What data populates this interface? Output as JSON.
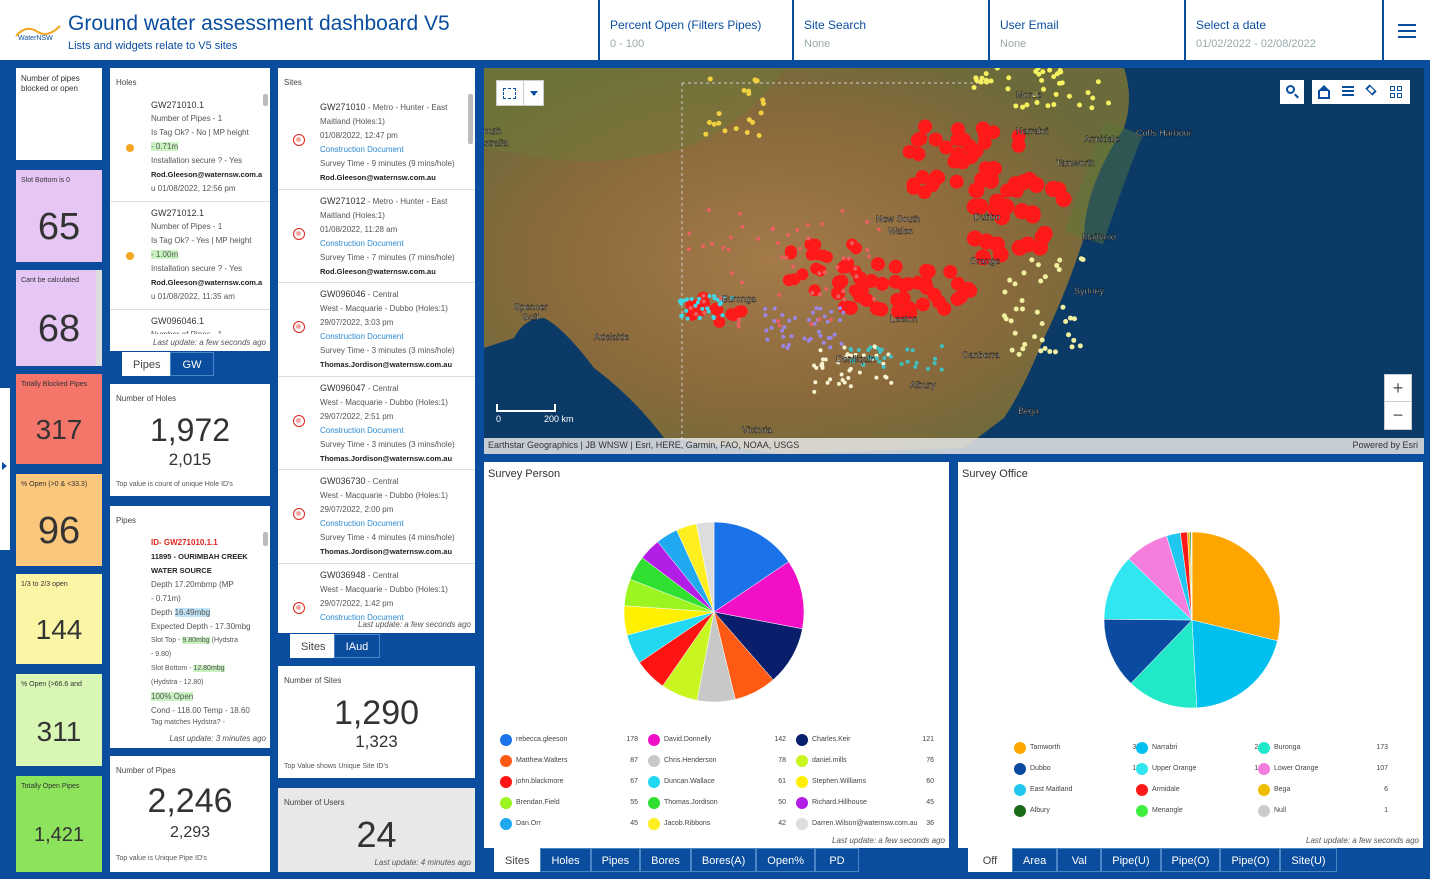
{
  "header": {
    "logo_text": "WaterNSW",
    "title": "Ground water assessment dashboard V5",
    "subtitle": "Lists and widgets relate to V5 sites",
    "filters": [
      {
        "label": "Percent Open (Filters Pipes)",
        "value": "0 - 100"
      },
      {
        "label": "Site Search",
        "value": "None"
      },
      {
        "label": "User Email",
        "value": "None"
      },
      {
        "label": "Select a date",
        "value": "01/02/2022 - 02/08/2022"
      }
    ]
  },
  "indicators": [
    {
      "title": "Number of pipes blocked or open",
      "value": "",
      "color": "#ffffff"
    },
    {
      "title": "Slot Bottom is 0",
      "value": "65",
      "color": "#e6c6f5"
    },
    {
      "title": "Cant be calculated",
      "value": "68",
      "color": "#e6c6f5"
    },
    {
      "title": "Totally Blocked Pipes",
      "value": "317",
      "color": "#f4756a"
    },
    {
      "title": "% Open (>0 & <33.3)",
      "value": "96",
      "color": "#fbc77c"
    },
    {
      "title": "1/3 to 2/3 open",
      "value": "144",
      "color": "#fbf6a6"
    },
    {
      "title": "% Open (>66.6 and",
      "value": "311",
      "color": "#d8f7b4"
    },
    {
      "title": "Totally Open Pipes",
      "value": "1,421",
      "color": "#8ee35d"
    }
  ],
  "holes": {
    "title": "Holes",
    "items": [
      {
        "id": "GW271010.1",
        "pipes": "Number of Pipes - 1",
        "tag": "Is Tag Ok? - No | MP height",
        "height": "- 0.71m",
        "install": "Installation secure ? - Yes",
        "email": "Rod.Gleeson@waternsw.com.a",
        "date": "u 01/08/2022, 12:56 pm"
      },
      {
        "id": "GW271012.1",
        "pipes": "Number of Pipes - 1",
        "tag": "Is Tag Ok? - Yes | MP height",
        "height": "- 1.00m",
        "install": "Installation secure ? - Yes",
        "email": "Rod.Gleeson@waternsw.com.a",
        "date": "u 01/08/2022, 11:35 am"
      },
      {
        "id": "GW096046.1",
        "pipes": "Number of Pipes - 1"
      }
    ],
    "updated": "Last update: a few seconds ago",
    "tabs": [
      "Pipes",
      "GW"
    ]
  },
  "number_of_holes": {
    "title": "Number of Holes",
    "value": "1,972",
    "subvalue": "2,015",
    "note": "Top value is count of unique Hole ID's"
  },
  "pipes": {
    "title": "Pipes",
    "id": "ID- GW271010.1.1",
    "site": "11895 - OURIMBAH CREEK",
    "source": "WATER SOURCE",
    "depth": "Depth 17.20mbmp (MP",
    "depth2": "- 0.71m)",
    "depth_label": "Depth",
    "depth_val": "16.49mbg",
    "expected": "Expected Depth - 17.30mbg",
    "slot_top_label": "Slot Top -",
    "slot_top_val": "9.80mbg",
    "slot_top_hyd": "(Hydstra",
    "slot_top_hyd2": "- 9.80)",
    "slot_bottom_label": "Slot Bottom -",
    "slot_bottom_val": "12.80mbg",
    "slot_bottom_hyd": "(Hydstra - 12.80)",
    "open": "100% Open",
    "cond": "Cond - 118.00 Temp - 18.60",
    "tag": "Tag matches Hydstra? -",
    "updated": "Last update: 3 minutes ago"
  },
  "number_of_pipes": {
    "title": "Number of Pipes",
    "value": "2,246",
    "subvalue": "2,293",
    "note": "Top value is Unique Pipe ID's"
  },
  "sites": {
    "title": "Sites",
    "items": [
      {
        "id": "GW271010",
        "l1": " - Metro - Hunter - East",
        "l2": "Maitland (Holes:1)",
        "date": "01/08/2022, 12:47 pm",
        "doc": "Construction Document",
        "survey": "Survey Time - 9 minutes (9 mins/hole)",
        "email": "Rod.Gleeson@waternsw.com.au"
      },
      {
        "id": "GW271012",
        "l1": " - Metro - Hunter - East",
        "l2": "Maitland (Holes:1)",
        "date": "01/08/2022, 11:28 am",
        "doc": "Construction Document",
        "survey": "Survey Time - 7 minutes (7 mins/hole)",
        "email": "Rod.Gleeson@waternsw.com.au"
      },
      {
        "id": "GW096046",
        "l1": " - Central",
        "l2": "West - Macquarie - Dubbo (Holes:1)",
        "date": "29/07/2022, 3:03 pm",
        "doc": "Construction Document",
        "survey": "Survey Time - 3 minutes (3 mins/hole)",
        "email": "Thomas.Jordison@waternsw.com.au"
      },
      {
        "id": "GW096047",
        "l1": " - Central",
        "l2": "West - Macquarie - Dubbo (Holes:1)",
        "date": "29/07/2022, 2:51 pm",
        "doc": "Construction Document",
        "survey": "Survey Time - 3 minutes (3 mins/hole)",
        "email": "Thomas.Jordison@waternsw.com.au"
      },
      {
        "id": "GW036730",
        "l1": " - Central",
        "l2": "West - Macquarie - Dubbo (Holes:1)",
        "date": "29/07/2022, 2:00 pm",
        "doc": "Construction Document",
        "survey": "Survey Time - 4 minutes (4 mins/hole)",
        "email": "Thomas.Jordison@waternsw.com.au"
      },
      {
        "id": "GW036948",
        "l1": " - Central",
        "l2": "West - Macquarie - Dubbo (Holes:1)",
        "date": "29/07/2022, 1:42 pm",
        "doc": "Construction Document",
        "survey": "",
        "email": ""
      }
    ],
    "updated": "Last update: a few seconds ago",
    "tabs": [
      "Sites",
      "IAud"
    ]
  },
  "number_of_sites": {
    "title": "Number of Sites",
    "value": "1,290",
    "subvalue": "1,323",
    "note": "Top Value shows Unique Site ID's"
  },
  "number_of_users": {
    "title": "Number of Users",
    "value": "24",
    "updated": "Last update: 4 minutes ago"
  },
  "map": {
    "labels": [
      "Moree",
      "Narrabri",
      "Armidale",
      "Coffs Harbour",
      "Tamworth",
      "New South",
      "Wales",
      "Dubbo",
      "Maitland",
      "Orange",
      "Sydney",
      "Buronga",
      "Leeton",
      "Adelaide",
      "Spencer",
      "Gulf",
      "Deniliquin",
      "Canberra",
      "Albury",
      "Victoria",
      "Bega",
      "outh",
      "stralia"
    ],
    "scale": "200 km",
    "scale_zero": "0",
    "attribution": "Earthstar Geographics | JB WNSW | Esri, HERE, Garmin, FAO, NOAA, USGS",
    "powered": "Powered by Esri",
    "zoom_in": "+",
    "zoom_out": "−"
  },
  "survey_person": {
    "title": "Survey Person",
    "updated": "Last update: a few seconds ago",
    "tabs": [
      "Sites",
      "Holes",
      "Pipes",
      "Bores",
      "Bores(A)",
      "Open%",
      "PD"
    ],
    "chart_data": {
      "type": "pie",
      "title": "Survey Person",
      "categories": [
        "rebecca.gleeson",
        "David.Donnelly",
        "Charles.Keir",
        "Matthew.Walters",
        "Chris.Henderson",
        "daniel.mills",
        "john.blackmore",
        "Duncan.Wallace",
        "Stephen.Williams",
        "Brendan.Field",
        "Thomas.Jordison",
        "Richard.Hillhouse",
        "Dan.Orr",
        "Jacob.Ribbons",
        "Darren.Wilson@waternsw.com.au"
      ],
      "values": [
        178,
        142,
        121,
        87,
        78,
        76,
        67,
        61,
        60,
        55,
        50,
        45,
        45,
        42,
        36
      ],
      "colors": [
        "#1a73e8",
        "#f20fc8",
        "#0a1f6b",
        "#ff5a14",
        "#c8c8c8",
        "#c9f520",
        "#ff1414",
        "#22d8f0",
        "#fff000",
        "#9cf520",
        "#30e030",
        "#b31ee6",
        "#20a8f0",
        "#ffee20",
        "#dddddd"
      ]
    }
  },
  "survey_office": {
    "title": "Survey Office",
    "updated": "Last update: a few seconds ago",
    "tabs": [
      "Off",
      "Area",
      "Val",
      "Pipe(U)",
      "Pipe(O)",
      "Pipe(O)",
      "Site(U)"
    ],
    "chart_data": {
      "type": "pie",
      "title": "Survey Office",
      "categories": [
        "Tamworth",
        "Narrabri",
        "Buronga",
        "Dubbo",
        "Upper Orange",
        "Lower Orange",
        "East Maitland",
        "Armidale",
        "Bega",
        "Albury",
        "Menangle",
        "Null"
      ],
      "values": [
        381,
        269,
        173,
        171,
        160,
        107,
        34,
        17,
        6,
        3,
        1,
        1
      ],
      "colors": [
        "#ffa500",
        "#00c0f0",
        "#20e8c8",
        "#0a4aa0",
        "#30e6f0",
        "#f57ddc",
        "#20c8f0",
        "#ff1a1a",
        "#f0c000",
        "#1a6a1a",
        "#40ee40",
        "#cccccc"
      ]
    }
  }
}
